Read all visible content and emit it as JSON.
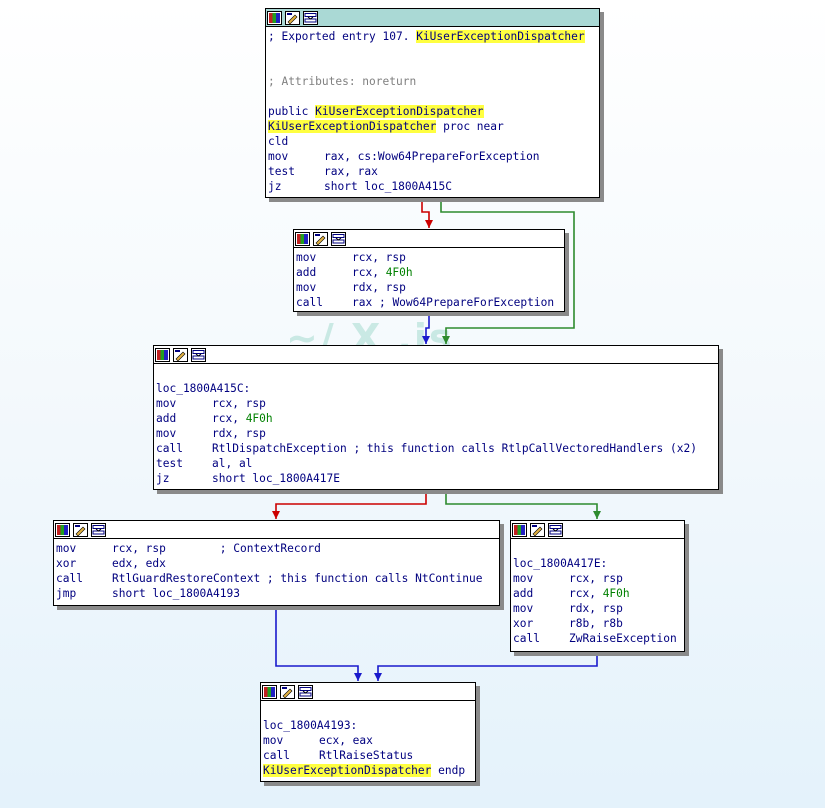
{
  "watermark": "~/ X .is",
  "nodes": {
    "entry": {
      "lines": [
        {
          "type": "comment",
          "prefix": "; Exported entry 107. ",
          "hl": "KiUserExceptionDispatcher"
        },
        {
          "type": "blank"
        },
        {
          "type": "blank"
        },
        {
          "type": "attr",
          "text": "; Attributes: noreturn"
        },
        {
          "type": "blank"
        },
        {
          "type": "public",
          "kw": "public ",
          "hl": "KiUserExceptionDispatcher"
        },
        {
          "type": "proc",
          "hl": "KiUserExceptionDispatcher",
          "rest": " proc near"
        },
        {
          "type": "ins",
          "mn": "cld",
          "ops": []
        },
        {
          "type": "ins",
          "mn": "mov",
          "ops": [
            {
              "t": "rax, cs:",
              "c": "op"
            },
            {
              "t": "Wow64PrepareForException",
              "c": "ext"
            }
          ]
        },
        {
          "type": "ins",
          "mn": "test",
          "ops": [
            {
              "t": "rax, rax",
              "c": "op"
            }
          ]
        },
        {
          "type": "ins",
          "mn": "jz",
          "ops": [
            {
              "t": "short loc_1800A415C",
              "c": "op"
            }
          ]
        }
      ]
    },
    "prepare": {
      "lines": [
        {
          "type": "ins",
          "mn": "mov",
          "ops": [
            {
              "t": "rcx, rsp",
              "c": "op"
            }
          ]
        },
        {
          "type": "ins",
          "mn": "add",
          "ops": [
            {
              "t": "rcx, ",
              "c": "op"
            },
            {
              "t": "4F0h",
              "c": "num"
            }
          ]
        },
        {
          "type": "ins",
          "mn": "mov",
          "ops": [
            {
              "t": "rdx, rsp",
              "c": "op"
            }
          ]
        },
        {
          "type": "ins",
          "mn": "call",
          "ops": [
            {
              "t": "rax",
              "c": "op"
            },
            {
              "t": " ; ",
              "c": "cm"
            },
            {
              "t": "Wow64PrepareForException",
              "c": "ext"
            }
          ]
        }
      ]
    },
    "dispatch": {
      "lines": [
        {
          "type": "blank"
        },
        {
          "type": "label",
          "text": "loc_1800A415C:"
        },
        {
          "type": "ins",
          "mn": "mov",
          "ops": [
            {
              "t": "rcx, rsp",
              "c": "op"
            }
          ]
        },
        {
          "type": "ins",
          "mn": "add",
          "ops": [
            {
              "t": "rcx, ",
              "c": "op"
            },
            {
              "t": "4F0h",
              "c": "num"
            }
          ]
        },
        {
          "type": "ins",
          "mn": "mov",
          "ops": [
            {
              "t": "rdx, rsp",
              "c": "op"
            }
          ]
        },
        {
          "type": "ins",
          "mn": "call",
          "ops": [
            {
              "t": "RtlDispatchException",
              "c": "ext"
            },
            {
              "t": " ; this function calls RtlpCallVectoredHandlers (x2)",
              "c": "cm"
            }
          ]
        },
        {
          "type": "ins",
          "mn": "test",
          "ops": [
            {
              "t": "al, al",
              "c": "op"
            }
          ]
        },
        {
          "type": "ins",
          "mn": "jz",
          "ops": [
            {
              "t": "short loc_1800A417E",
              "c": "op"
            }
          ]
        }
      ]
    },
    "restore": {
      "lines": [
        {
          "type": "ins",
          "mn": "mov",
          "ops": [
            {
              "t": "rcx, rsp",
              "c": "op"
            },
            {
              "t": "        ; ContextRecord",
              "c": "cm"
            }
          ]
        },
        {
          "type": "ins",
          "mn": "xor",
          "ops": [
            {
              "t": "edx, edx",
              "c": "op"
            }
          ]
        },
        {
          "type": "ins",
          "mn": "call",
          "ops": [
            {
              "t": "RtlGuardRestoreContext",
              "c": "ext"
            },
            {
              "t": " ; this function calls NtContinue",
              "c": "cm"
            }
          ]
        },
        {
          "type": "ins",
          "mn": "jmp",
          "ops": [
            {
              "t": "short loc_1800A4193",
              "c": "op"
            }
          ]
        }
      ]
    },
    "raise": {
      "lines": [
        {
          "type": "blank"
        },
        {
          "type": "label",
          "text": "loc_1800A417E:"
        },
        {
          "type": "ins",
          "mn": "mov",
          "ops": [
            {
              "t": "rcx, rsp",
              "c": "op"
            }
          ]
        },
        {
          "type": "ins",
          "mn": "add",
          "ops": [
            {
              "t": "rcx, ",
              "c": "op"
            },
            {
              "t": "4F0h",
              "c": "num"
            }
          ]
        },
        {
          "type": "ins",
          "mn": "mov",
          "ops": [
            {
              "t": "rdx, rsp",
              "c": "op"
            }
          ]
        },
        {
          "type": "ins",
          "mn": "xor",
          "ops": [
            {
              "t": "r8b, r8b",
              "c": "op"
            }
          ]
        },
        {
          "type": "ins",
          "mn": "call",
          "ops": [
            {
              "t": "ZwRaiseException",
              "c": "ext"
            }
          ]
        }
      ]
    },
    "status": {
      "lines": [
        {
          "type": "blank"
        },
        {
          "type": "label",
          "text": "loc_1800A4193:"
        },
        {
          "type": "ins",
          "mn": "mov",
          "ops": [
            {
              "t": "ecx, eax",
              "c": "op"
            }
          ]
        },
        {
          "type": "ins",
          "mn": "call",
          "ops": [
            {
              "t": "RtlRaiseStatus",
              "c": "ext"
            }
          ]
        },
        {
          "type": "endp",
          "hl": "KiUserExceptionDispatcher",
          "rest": " endp"
        }
      ]
    }
  },
  "colors": {
    "edge_true": "#cc0000",
    "edge_false": "#2e8b2e",
    "edge_uncond": "#1a1acc"
  }
}
